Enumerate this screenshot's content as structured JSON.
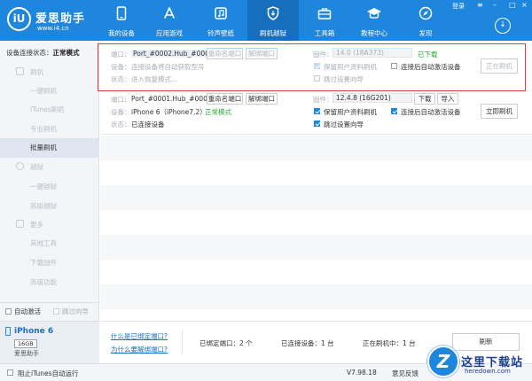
{
  "brand": {
    "logo_mark": "iU",
    "name": "爱思助手",
    "url": "www.i4.cn"
  },
  "nav": [
    {
      "label": "我的设备",
      "icon": "phone-icon"
    },
    {
      "label": "应用游戏",
      "icon": "appstore-icon"
    },
    {
      "label": "铃声壁纸",
      "icon": "music-wallpaper-icon"
    },
    {
      "label": "刷机越狱",
      "icon": "shield-icon"
    },
    {
      "label": "工具箱",
      "icon": "toolbox-icon"
    },
    {
      "label": "教程中心",
      "icon": "graduation-icon"
    },
    {
      "label": "发现",
      "icon": "compass-icon"
    }
  ],
  "nav_active": "刷机越狱",
  "header": {
    "login": "登录"
  },
  "sidebar": {
    "status_label": "设备连接状态：",
    "status_value": "正常模式",
    "items": [
      {
        "label": "刷机",
        "type": "group"
      },
      {
        "label": "一键刷机",
        "type": "sub"
      },
      {
        "label": "iTunes刷机",
        "type": "sub"
      },
      {
        "label": "专业刷机",
        "type": "sub"
      },
      {
        "label": "批量刷机",
        "type": "sub",
        "active": true
      },
      {
        "label": "越狱",
        "type": "group"
      },
      {
        "label": "一键越狱",
        "type": "sub"
      },
      {
        "label": "高级越狱",
        "type": "sub"
      },
      {
        "label": "更多",
        "type": "group"
      },
      {
        "label": "其他工具",
        "type": "sub"
      },
      {
        "label": "下载固件",
        "type": "sub"
      },
      {
        "label": "高级功能",
        "type": "sub"
      }
    ],
    "auto_activate": "自动激活",
    "skip_guide": "跳过向导",
    "device": {
      "name": "iPhone 6",
      "capacity": "16GB",
      "app": "爱思助手"
    }
  },
  "ports": [
    {
      "port_label": "端口：",
      "port_value": "Port_#0002.Hub_#0003",
      "rename": "重命名端口",
      "unbind": "解绑端口",
      "device_label": "设备：",
      "device_value": "连接设备将自动获取型号",
      "state_label": "状态：",
      "state_value": "进入恢复模式...",
      "firmware_label": "固件：",
      "firmware_value": "14.0 (18A373)",
      "firmware_status": "已下载",
      "opt_keep_data": "保留用户资料刷机",
      "opt_auto_activate": "连接后自动激活设备",
      "opt_skip_guide": "跳过设置向导",
      "action": "正在刷机"
    },
    {
      "port_label": "端口：",
      "port_value": "Port_#0001.Hub_#0003",
      "rename": "重命名端口",
      "unbind": "解绑端口",
      "device_label": "设备：",
      "device_value": "iPhone 6（iPhone7,2）",
      "device_mode": "正常模式",
      "state_label": "状态：",
      "state_value": "已连接设备",
      "firmware_label": "固件：",
      "firmware_value": "12.4.8 (16G201)",
      "download": "下载",
      "import": "导入",
      "opt_keep_data": "保留用户资料刷机",
      "opt_auto_activate": "连接后自动激活设备",
      "opt_skip_guide": "跳过设置向导",
      "action": "立即刷机"
    }
  ],
  "footer": {
    "help_bind": "什么是已绑定端口?",
    "help_why": "为什么要解绑端口?",
    "bound_ports": "已绑定端口：2 个",
    "connected": "已连接设备：1 台",
    "flashing": "正在刷机中：1 台",
    "refresh": "刷新"
  },
  "statusbar": {
    "block_itunes": "阻止iTunes自动运行",
    "version": "V7.98.18",
    "feedback": "意见反馈"
  },
  "watermark": {
    "mark": "Z",
    "text": "这里下载站",
    "url": "heredown.com"
  },
  "colors": {
    "brand": "#1e86dc",
    "highlight": "#e23b3b",
    "ok": "#2aa63a"
  }
}
